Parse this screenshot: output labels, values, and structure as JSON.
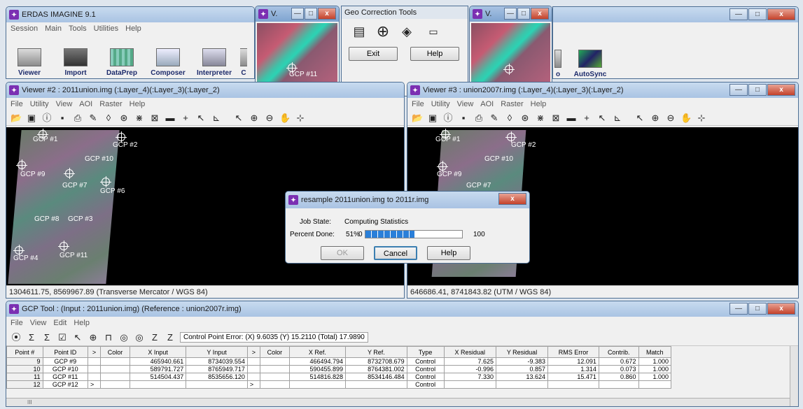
{
  "desktop_bg": "#dfe6ee",
  "accent": "#3a7bd5",
  "erdas": {
    "title": "ERDAS IMAGINE 9.1",
    "menu": [
      "Session",
      "Main",
      "Tools",
      "Utilities",
      "Help"
    ],
    "buttons": [
      "Viewer",
      "Import",
      "DataPrep",
      "Composer",
      "Interpreter"
    ],
    "partial_buttons": {
      "cut_left": "C",
      "cut_right": "o"
    },
    "autosync": "AutoSync"
  },
  "zoom1": {
    "title": "V.",
    "label": "GCP #11"
  },
  "zoom2": {
    "title": "V."
  },
  "geotools": {
    "title": "Geo Correction Tools",
    "exit": "Exit",
    "help": "Help"
  },
  "viewer2": {
    "title": "Viewer #2 : 2011union.img (:Layer_4)(:Layer_3)(:Layer_2)",
    "menu": [
      "File",
      "Utility",
      "View",
      "AOI",
      "Raster",
      "Help"
    ],
    "status": "1304611.75, 8569967.89  (Transverse Mercator / WGS 84)",
    "gcps": [
      "GCP #1",
      "GCP #2",
      "GCP #10",
      "GCP #9",
      "GCP #7",
      "GCP #6",
      "GCP #8",
      "GCP #3",
      "GCP #4",
      "GCP #11"
    ]
  },
  "viewer3": {
    "title": "Viewer #3 : union2007r.img (:Layer_4)(:Layer_3)(:Layer_2)",
    "menu": [
      "File",
      "Utility",
      "View",
      "AOI",
      "Raster",
      "Help"
    ],
    "status": "646686.41, 8741843.82  (UTM / WGS 84)",
    "gcps": [
      "GCP #1",
      "GCP #2",
      "GCP #10",
      "GCP #9",
      "GCP #7"
    ]
  },
  "resample": {
    "title": "resample 2011union.img to 2011r.img",
    "job_state_label": "Job State:",
    "job_state": "Computing Statistics",
    "percent_label": "Percent Done:",
    "percent": "51%",
    "progress_value": 0.51,
    "min": "0",
    "max": "100",
    "ok": "OK",
    "cancel": "Cancel",
    "help": "Help"
  },
  "gcptool": {
    "title": "GCP Tool : (Input : 2011union.img) (Reference : union2007r.img)",
    "menu": [
      "File",
      "View",
      "Edit",
      "Help"
    ],
    "control_error": "Control Point Error: (X) 9.6035   (Y) 15.2110   (Total) 17.9890",
    "columns": [
      "Point #",
      "Point ID",
      ">",
      "Color",
      "X Input",
      "Y Input",
      ">",
      "Color",
      "X Ref.",
      "Y Ref.",
      "Type",
      "X Residual",
      "Y Residual",
      "RMS Error",
      "Contrib.",
      "Match"
    ],
    "rows": [
      [
        "9",
        "GCP #9",
        "",
        "",
        "465940.661",
        "8734039.554",
        "",
        "",
        "466494.794",
        "8732708.679",
        "Control",
        "7.625",
        "-9.383",
        "12.091",
        "0.672",
        "1.000"
      ],
      [
        "10",
        "GCP #10",
        "",
        "",
        "589791.727",
        "8765949.717",
        "",
        "",
        "590455.899",
        "8764381.002",
        "Control",
        "-0.996",
        "0.857",
        "1.314",
        "0.073",
        "1.000"
      ],
      [
        "11",
        "GCP #11",
        "",
        "",
        "514504.437",
        "8535656.120",
        "",
        "",
        "514816.828",
        "8534146.484",
        "Control",
        "7.330",
        "13.624",
        "15.471",
        "0.860",
        "1.000"
      ],
      [
        "12",
        "GCP #12",
        ">",
        "",
        "",
        "",
        ">",
        "",
        "",
        "",
        "Control",
        "",
        "",
        "",
        "",
        ""
      ]
    ],
    "scroll_marker": "III"
  }
}
